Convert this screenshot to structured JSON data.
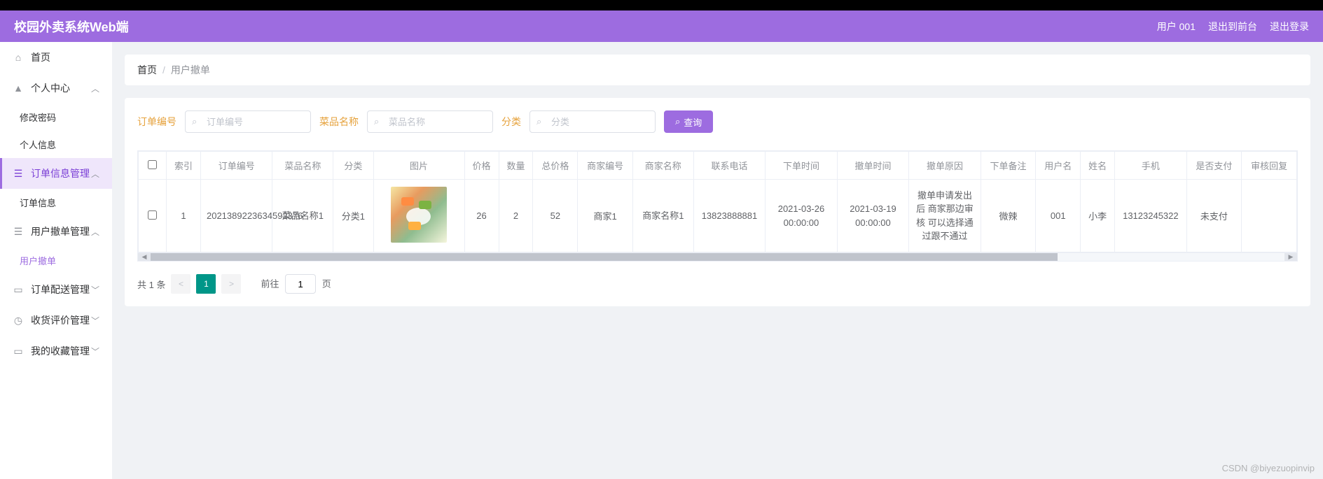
{
  "header": {
    "title": "校园外卖系统Web端",
    "user": "用户 001",
    "logout_front": "退出到前台",
    "logout": "退出登录"
  },
  "sidebar": {
    "home": "首页",
    "personal_center": "个人中心",
    "change_password": "修改密码",
    "personal_info": "个人信息",
    "order_info_mgmt": "订单信息管理",
    "order_info": "订单信息",
    "user_cancel_mgmt": "用户撤单管理",
    "user_cancel": "用户撤单",
    "delivery_mgmt": "订单配送管理",
    "review_mgmt": "收货评价管理",
    "favorites_mgmt": "我的收藏管理"
  },
  "breadcrumb": {
    "home": "首页",
    "current": "用户撤单"
  },
  "search": {
    "order_no_label": "订单编号",
    "order_no_placeholder": "订单编号",
    "dish_name_label": "菜品名称",
    "dish_name_placeholder": "菜品名称",
    "category_label": "分类",
    "category_placeholder": "分类",
    "query_btn": "查询"
  },
  "table": {
    "headers": [
      "索引",
      "订单编号",
      "菜品名称",
      "分类",
      "图片",
      "价格",
      "数量",
      "总价格",
      "商家编号",
      "商家名称",
      "联系电话",
      "下单时间",
      "撤单时间",
      "撤单原因",
      "下单备注",
      "用户名",
      "姓名",
      "手机",
      "是否支付",
      "审核回复"
    ],
    "rows": [
      {
        "index": "1",
        "order_no": "2021389223634592376",
        "dish_name": "菜品名称1",
        "category": "分类1",
        "price": "26",
        "qty": "2",
        "total": "52",
        "merchant_no": "商家1",
        "merchant_name": "商家名称1",
        "phone": "13823888881",
        "order_time": "2021-03-26 00:00:00",
        "cancel_time": "2021-03-19 00:00:00",
        "cancel_reason": "撤单申请发出后 商家那边审核 可以选择通过跟不通过",
        "remark": "微辣",
        "username": "001",
        "name": "小李",
        "mobile": "13123245322",
        "paid": "未支付",
        "review_reply": ""
      }
    ]
  },
  "pagination": {
    "total_text": "共 1 条",
    "current_page": "1",
    "jump_prefix": "前往",
    "jump_input": "1",
    "jump_suffix": "页"
  },
  "watermark": "CSDN @biyezuopinvip"
}
